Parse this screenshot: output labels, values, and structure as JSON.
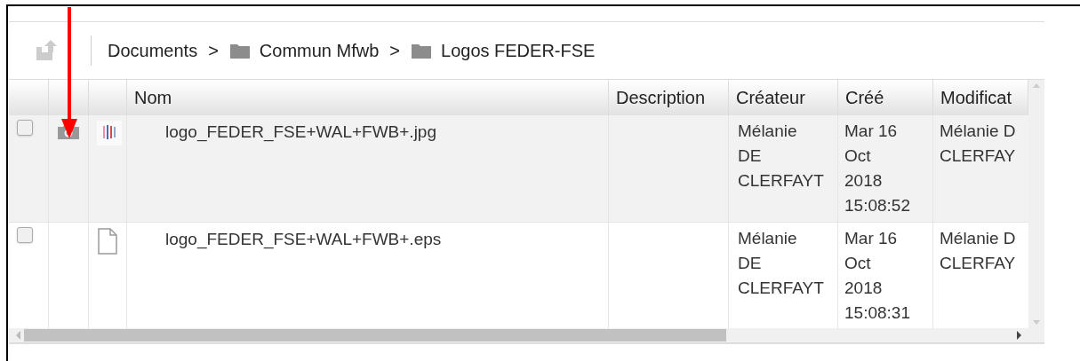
{
  "breadcrumb": [
    {
      "label": "Documents",
      "kind": "root"
    },
    {
      "label": "Commun Mfwb",
      "kind": "folder"
    },
    {
      "label": "Logos FEDER-FSE",
      "kind": "folder"
    }
  ],
  "breadcrumb_separator": ">",
  "table": {
    "columns": [
      "Nom",
      "Description",
      "Créateur",
      "Créé",
      "Modificat"
    ],
    "rows": [
      {
        "checked": false,
        "highlighted": true,
        "preview": true,
        "kind": "image",
        "name": "logo_FEDER_FSE+WAL+FWB+.jpg",
        "creator": [
          "Mélanie",
          "DE",
          "CLERFAYT"
        ],
        "created": [
          "Mar 16",
          "Oct",
          "2018",
          "15:08:52"
        ],
        "modified_by": [
          "Mélanie D",
          "CLERFAY"
        ]
      },
      {
        "checked": false,
        "highlighted": false,
        "preview": false,
        "kind": "file",
        "name": "logo_FEDER_FSE+WAL+FWB+.eps",
        "creator": [
          "Mélanie",
          "DE",
          "CLERFAYT"
        ],
        "created": [
          "Mar 16",
          "Oct",
          "2018",
          "15:08:31"
        ],
        "modified_by": [
          "Mélanie D",
          "CLERFAY"
        ]
      }
    ]
  },
  "annotation": {
    "kind": "arrow"
  }
}
